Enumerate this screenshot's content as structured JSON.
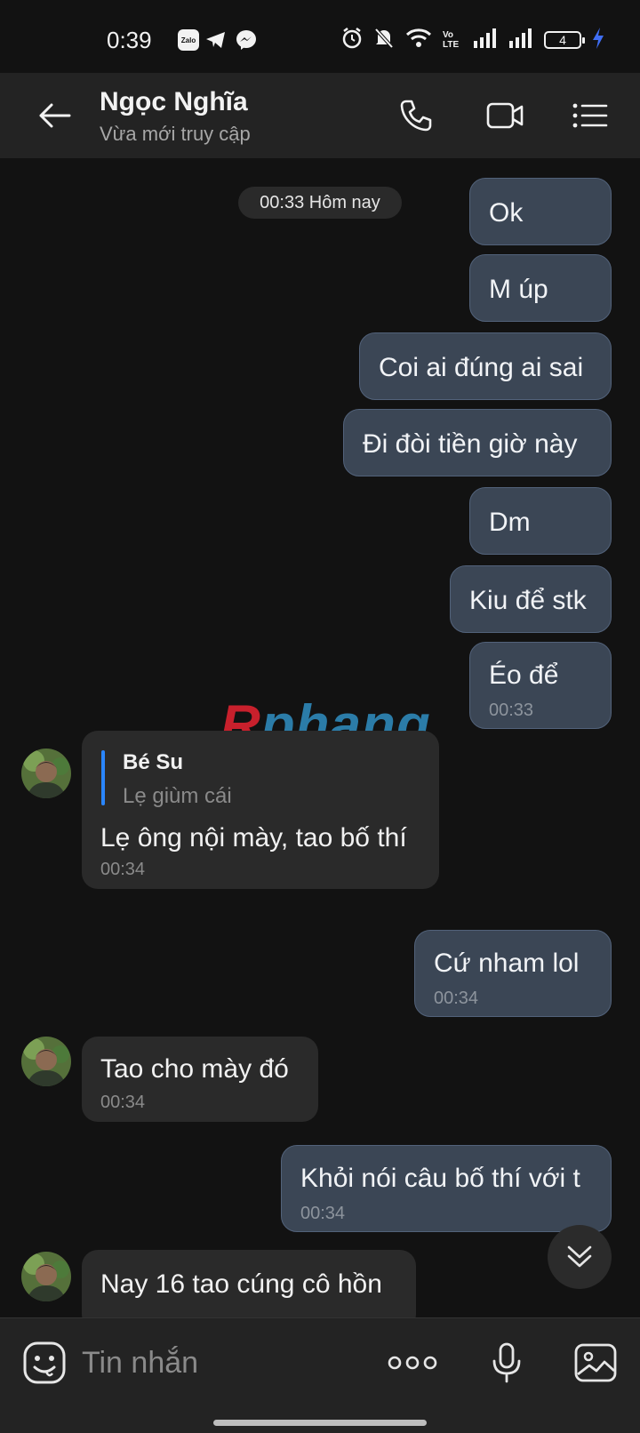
{
  "status_bar": {
    "time": "0:39",
    "zalo_label": "Zalo",
    "volte_label": "Vo LTE",
    "battery": "4"
  },
  "header": {
    "contact_name": "Ngọc Nghĩa",
    "status": "Vừa mới truy cập",
    "icons": [
      "back-arrow-icon",
      "phone-icon",
      "video-call-icon",
      "menu-icon"
    ]
  },
  "chat": {
    "date_divider": "00:33 Hôm nay",
    "watermark": {
      "part1": "R",
      "part2": "phang"
    },
    "messages": [
      {
        "dir": "out",
        "text": "Ok"
      },
      {
        "dir": "out",
        "text": "M úp"
      },
      {
        "dir": "out",
        "text": "Coi ai đúng ai sai"
      },
      {
        "dir": "out",
        "text": "Đi đòi tiền giờ này"
      },
      {
        "dir": "out",
        "text": "Dm"
      },
      {
        "dir": "out",
        "text": "Kiu để stk"
      },
      {
        "dir": "out",
        "text": "Éo để",
        "time": "00:33"
      },
      {
        "dir": "in",
        "reply_to": {
          "name": "Bé Su",
          "text": "Lẹ giùm cái"
        },
        "text": "Lẹ ông nội mày, tao bố thí",
        "time": "00:34"
      },
      {
        "dir": "out",
        "text": "Cứ nham lol",
        "time": "00:34"
      },
      {
        "dir": "in",
        "text": "Tao cho mày đó",
        "time": "00:34"
      },
      {
        "dir": "out",
        "text": "Khỏi nói câu bố thí với t",
        "time": "00:34"
      },
      {
        "dir": "in",
        "text": "Nay 16 tao cúng cô hồn"
      }
    ]
  },
  "composer": {
    "placeholder": "Tin nhắn",
    "icons": [
      "emoji-icon",
      "more-options-icon",
      "microphone-icon",
      "gallery-icon"
    ]
  },
  "colors": {
    "background": "#121212",
    "header": "#232323",
    "outgoing_bubble": "#3b4655",
    "incoming_bubble": "#2a2a2a",
    "reply_accent": "#2a86ff"
  }
}
